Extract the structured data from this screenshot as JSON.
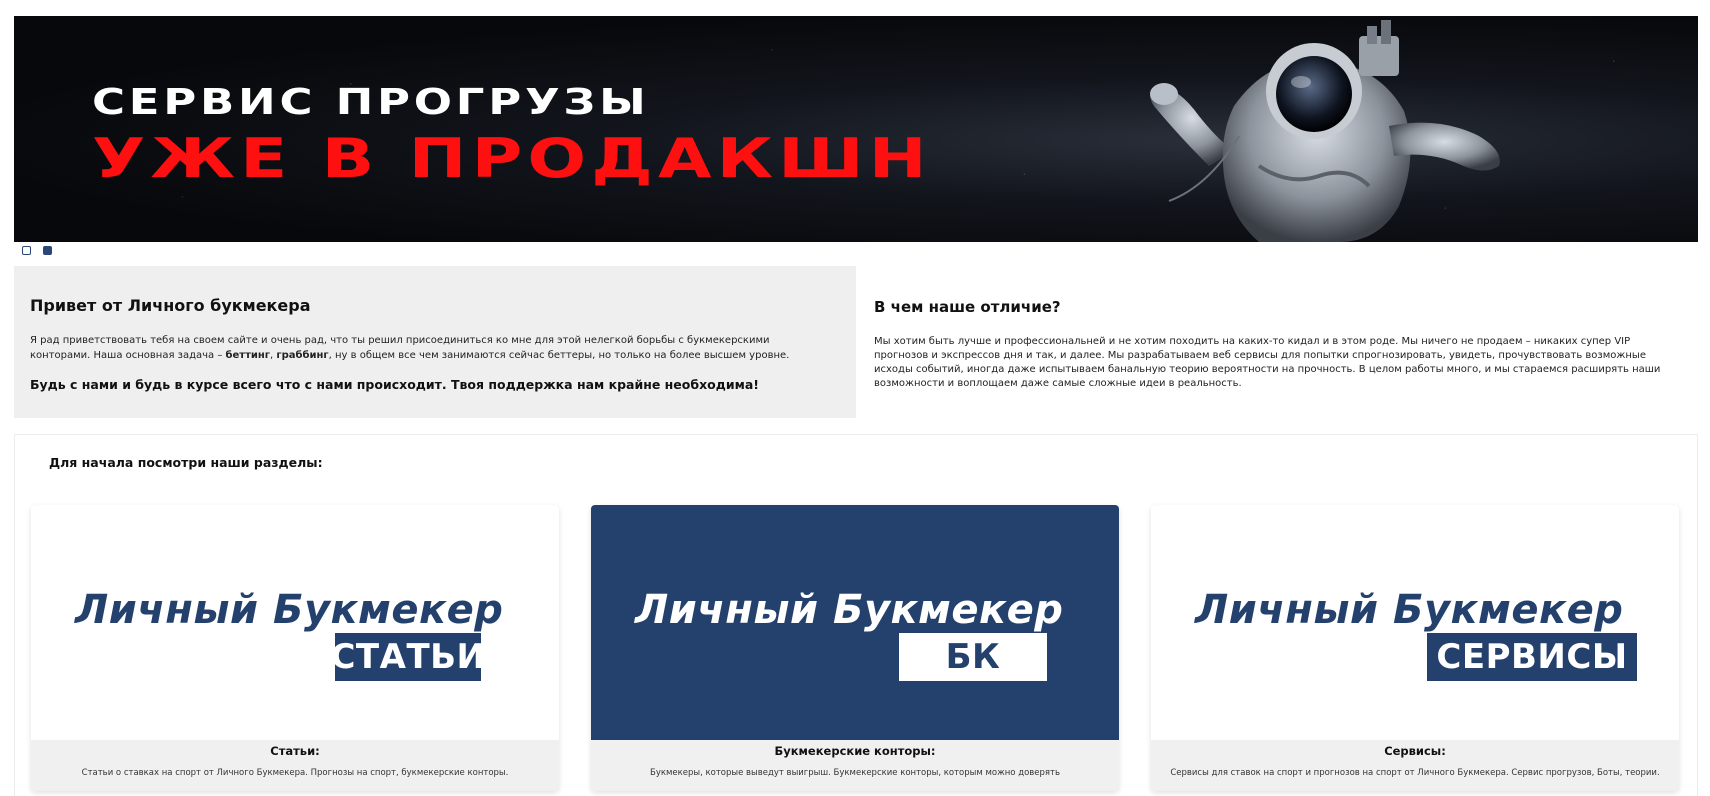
{
  "banner": {
    "line1": "СЕРВИС ПРОГРУЗЫ",
    "line2": "УЖЕ В ПРОДАКШН"
  },
  "slider": {
    "count": 2,
    "active": 2
  },
  "intro": {
    "title": "Привет от Личного букмекера",
    "body_start": "Я рад приветствовать тебя на своем сайте и очень рад, что ты решил присоединиться ко мне для этой нелегкой борьбы с букмекерскими конторами. Наша основная задача – ",
    "bold1": "беттинг",
    "sep": ", ",
    "bold2": "граббинг",
    "body_end": ", ну в общем все чем занимаются сейчас беттеры, но только на более высшем уровне.",
    "call": "Будь с нами и будь в курсе всего что с нами происходит. Твоя поддержка нам крайне необходима!"
  },
  "difference": {
    "title": "В чем наше отличие?",
    "body": "Мы хотим быть лучше и профессиональней и не хотим походить на каких-то кидал и в этом роде. Мы ничего не продаем – никаких супер VIP прогнозов и экспрессов дня и так, и далее. Мы разрабатываем веб сервисы для попытки спрогнозировать, увидеть, прочувствовать возможные исходы событий, иногда даже испытываем банальную теорию вероятности на прочность. В целом работы много, и мы стараемся расширять наши возможности и воплощаем даже самые сложные идеи в реальность."
  },
  "sections": {
    "lead": "Для начала посмотри наши разделы:",
    "cards": [
      {
        "logo_text": "Личный Букмекер",
        "badge": "СТАТЬИ",
        "title": "Статьи:",
        "desc": "Статьи о ставках на спорт от Личного Букмекера. Прогнозы на спорт, букмекерские конторы."
      },
      {
        "logo_text": "Личный Букмекер",
        "badge": "БК",
        "title": "Букмекерские конторы:",
        "desc": "Букмекеры, которые выведут выигрыш. Букмекерские конторы, которым можно доверять"
      },
      {
        "logo_text": "Личный Букмекер",
        "badge": "СЕРВИСЫ",
        "title": "Сервисы:",
        "desc": "Сервисы для ставок на спорт и прогнозов на спорт от Личного Букмекера. Сервис прогрузов, Боты, теории."
      }
    ]
  },
  "colors": {
    "brand": "#24416d",
    "banner_red": "#ff1010",
    "panel_bg": "#efefef"
  }
}
